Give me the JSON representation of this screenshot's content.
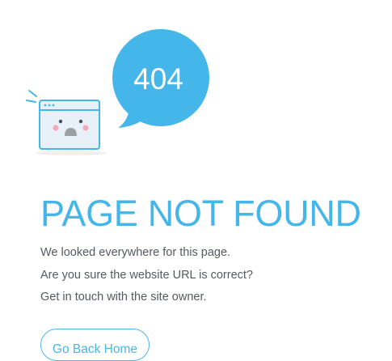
{
  "illustration": {
    "bubble_text": "404",
    "bubble_color": "#45b6e9",
    "window_icon": "sad-browser-window-icon"
  },
  "error": {
    "title": "PAGE NOT FOUND",
    "title_color": "#45b6e9",
    "messages": [
      "We looked everywhere for this page.",
      "Are you sure the website URL is correct?",
      "Get in touch with the site owner."
    ]
  },
  "actions": {
    "home_label": "Go Back Home",
    "accent_color": "#4bb6e6"
  }
}
